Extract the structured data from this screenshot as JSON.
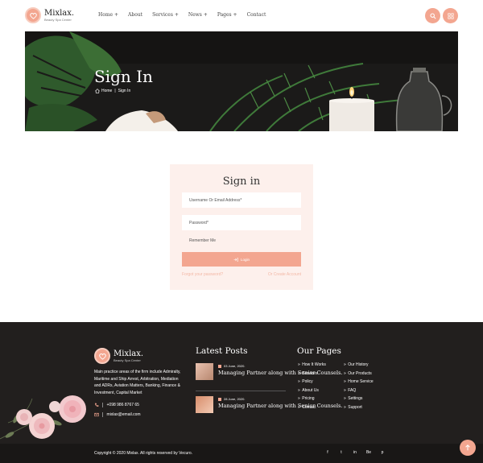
{
  "brand": {
    "name": "Mixlax.",
    "tagline": "Beauty Spa Center",
    "accent": "#f3a690"
  },
  "nav": {
    "items": [
      "Home +",
      "About",
      "Services +",
      "News +",
      "Pages +",
      "Contact"
    ]
  },
  "header_buttons": {
    "search_icon": "search-icon",
    "grid_icon": "grid-icon"
  },
  "banner": {
    "title": "Sign In",
    "breadcrumb": {
      "home": "Home",
      "separator": "|",
      "current": "Sign In"
    }
  },
  "signin": {
    "title": "Sign in",
    "username_placeholder": "Username Or Email Address*",
    "password_placeholder": "Password*",
    "remember_label": "Remember Me",
    "login_label": "Login",
    "forgot_label": "Forgot your password?",
    "create_label": "Or Create Account"
  },
  "footer": {
    "brand_name": "Mixlax.",
    "brand_tagline": "Beauty Spa Center",
    "description": "Main practice areas of the firm include Admiralty, Maritime and Ship Arrest, Arbitration, Mediation and ADRs, Aviation Matters, Banking, Finance & Investment, Capital Market",
    "phone": "+098 986 8767 65",
    "email": "mixlax@email.com",
    "latest_posts_heading": "Latest Posts",
    "posts": [
      {
        "date": "03 June, 2020.",
        "title": "Managing Partner along with Senior Counsels."
      },
      {
        "date": "28 June, 2020.",
        "title": "Managing Partner along with Senior Counsels."
      }
    ],
    "our_pages_heading": "Our Pages",
    "pages_col1": [
      "How It Works",
      "Services",
      "Policy",
      "About Us",
      "Pricing",
      "Contact"
    ],
    "pages_col2": [
      "Our History",
      "Our Products",
      "Home Service",
      "FAQ",
      "Settings",
      "Support"
    ],
    "copyright": "Copyright © 2020 Mixlax. All rights reserved by Vecuro.",
    "social": [
      "f",
      "t",
      "in",
      "Be",
      "p"
    ]
  }
}
